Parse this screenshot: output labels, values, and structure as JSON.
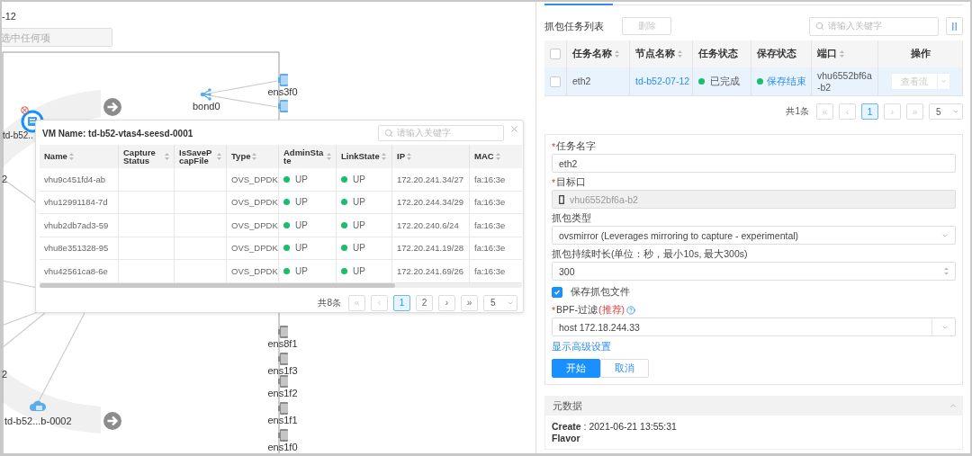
{
  "canvas": {
    "title": "-12",
    "select": {
      "placeholder": "选中任何项"
    },
    "nodes": [
      {
        "kind": "host",
        "label": "td-b52..",
        "selected": true,
        "alert": true
      },
      {
        "kind": "cloud",
        "label": "td-b52...b-0002",
        "alert": false
      }
    ],
    "bond": {
      "label": "bond0"
    },
    "ports": [
      {
        "label": "ens3f0",
        "active": true
      },
      {
        "active": true
      },
      {
        "label": "ens8f1",
        "active": false
      },
      {
        "label": "ens1f3",
        "active": false
      },
      {
        "label": "ens1f2",
        "active": false
      },
      {
        "label": "ens1f1",
        "active": false
      },
      {
        "label": "ens1f0",
        "active": false
      }
    ],
    "edge_labels": [
      "2",
      "2"
    ]
  },
  "popup": {
    "title": "VM Name: td-b52-vtas4-seesd-0001",
    "search": {
      "placeholder": "请输入关键字"
    },
    "columns": [
      {
        "label": "Name",
        "sortable": true
      },
      {
        "label": "Capture Status",
        "sortable": true
      },
      {
        "label": "IsSavePcapFile",
        "sortable": true
      },
      {
        "label": "Type",
        "sortable": true
      },
      {
        "label": "AdminState",
        "sortable": true
      },
      {
        "label": "LinkState",
        "sortable": true
      },
      {
        "label": "IP",
        "sortable": true
      },
      {
        "label": "MAC",
        "sortable": true
      }
    ],
    "rows": [
      {
        "name": "vhu9c451fd4-ab",
        "type": "OVS_DPDK",
        "admin_state": "UP",
        "link_state": "UP",
        "ip": "172.20.241.34/27",
        "mac": "fa:16:3e"
      },
      {
        "name": "vhu12991184-7d",
        "type": "OVS_DPDK",
        "admin_state": "UP",
        "link_state": "UP",
        "ip": "172.20.244.34/29",
        "mac": "fa:16:3e"
      },
      {
        "name": "vhub2db7ad3-59",
        "type": "OVS_DPDK",
        "admin_state": "UP",
        "link_state": "UP",
        "ip": "172.20.240.6/24",
        "mac": "fa:16:3e"
      },
      {
        "name": "vhu8e351328-95",
        "type": "OVS_DPDK",
        "admin_state": "UP",
        "link_state": "UP",
        "ip": "172.20.241.19/28",
        "mac": "fa:16:3e"
      },
      {
        "name": "vhu42561ca8-6e",
        "type": "OVS_DPDK",
        "admin_state": "UP",
        "link_state": "UP",
        "ip": "172.20.241.69/26",
        "mac": "fa:16:3e"
      }
    ],
    "pagination": {
      "total": "共8条",
      "nav_prev": [
        {
          "label": "«",
          "disabled": true
        },
        {
          "label": "‹",
          "disabled": true
        }
      ],
      "pages": [
        {
          "label": "1",
          "selected": true
        },
        {
          "label": "2",
          "selected": false
        }
      ],
      "nav_next": [
        {
          "label": "›",
          "disabled": false
        },
        {
          "label": "»",
          "disabled": false
        }
      ],
      "page_size": "5"
    }
  },
  "tasks": {
    "title": "抓包任务列表",
    "delete_button": {
      "label": "删除",
      "disabled": true
    },
    "search": {
      "placeholder": "请输入关键字"
    },
    "all_checked": false,
    "columns": [
      {
        "label": "任务名称",
        "sortable": true
      },
      {
        "label": "节点名称",
        "sortable": true
      },
      {
        "label": "任务状态",
        "sortable": false
      },
      {
        "label": "保存状态",
        "sortable": false
      },
      {
        "label": "端口",
        "sortable": true
      },
      {
        "label": "操作",
        "sortable": false
      }
    ],
    "rows": [
      {
        "checked": false,
        "selected": true,
        "task_name": "eth2",
        "node": "td-b52-07-12",
        "task_status": "已完成",
        "save_status": "保存结束",
        "port": "vhu6552bf6a-b2",
        "action": {
          "label": "查看流",
          "disabled": true
        }
      }
    ],
    "pagination": {
      "total": "共1条",
      "nav_prev": [
        {
          "label": "«",
          "disabled": true
        },
        {
          "label": "‹",
          "disabled": true
        }
      ],
      "pages": [
        {
          "label": "1",
          "selected": true
        }
      ],
      "nav_next": [
        {
          "label": "›",
          "disabled": true
        },
        {
          "label": "»",
          "disabled": true
        }
      ],
      "page_size": "5"
    }
  },
  "form": {
    "fields": [
      {
        "kind": "text",
        "label": {
          "mark": "*",
          "text": "任务名字"
        },
        "value": "eth2"
      },
      {
        "kind": "port",
        "label": {
          "mark": "*",
          "text": "目标口"
        },
        "value": "vhu6552bf6a-b2",
        "disabled": true
      },
      {
        "kind": "select",
        "label": {
          "text": "抓包类型"
        },
        "value": "ovsmirror (Leverages mirroring to capture - experimental)"
      },
      {
        "kind": "number",
        "label": {
          "text": "抓包持续时长(单位：秒，最小10s, 最大300s)"
        },
        "value": "300"
      },
      {
        "kind": "checkbox",
        "label": {
          "text": "保存抓包文件"
        },
        "checked": true
      },
      {
        "kind": "combo",
        "label": {
          "mark": "*",
          "text": "BPF-过滤",
          "note": "(推荐)",
          "help": true
        },
        "value": "host 172.18.244.33"
      }
    ],
    "advanced_link": "显示高级设置",
    "buttons": [
      {
        "label": "开始",
        "primary": true
      },
      {
        "label": "取消",
        "primary": false
      }
    ]
  },
  "metadata": {
    "title": "元数据",
    "expanded": true,
    "rows": [
      {
        "key": "Create",
        "value": ": 2021-06-21 13:55:31"
      },
      {
        "key": "Flavor"
      }
    ]
  }
}
